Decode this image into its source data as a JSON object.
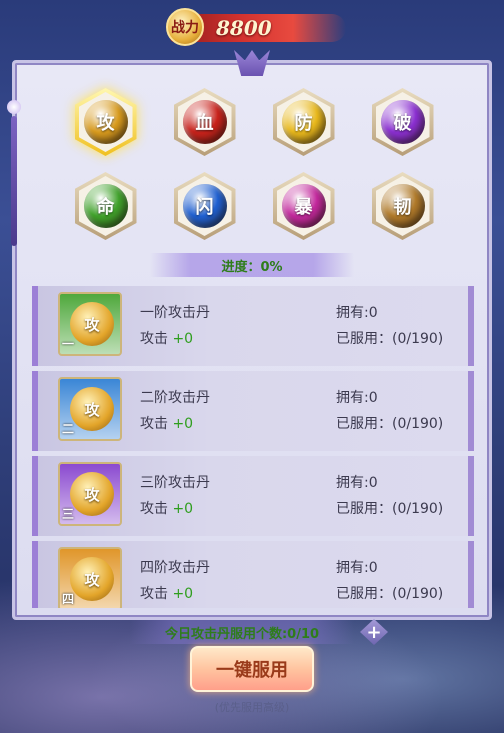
{
  "power": {
    "emblem": "战力",
    "value": "8800"
  },
  "gems": [
    {
      "label": "攻",
      "color": "#d79a1e",
      "selected": true
    },
    {
      "label": "血",
      "color": "#c8221b",
      "selected": false
    },
    {
      "label": "防",
      "color": "#e8b81c",
      "selected": false
    },
    {
      "label": "破",
      "color": "#8a2fd0",
      "selected": false
    },
    {
      "label": "命",
      "color": "#3fa12a",
      "selected": false
    },
    {
      "label": "闪",
      "color": "#1e5fd0",
      "selected": false
    },
    {
      "label": "暴",
      "color": "#c2289c",
      "selected": false
    },
    {
      "label": "韧",
      "color": "#b07a2a",
      "selected": false
    }
  ],
  "progress": {
    "text": "进度：0%"
  },
  "items": [
    {
      "name": "一阶攻击丹",
      "attr_label": "攻击",
      "bonus": "+0",
      "owned": "拥有:0",
      "used": "已服用：(0/190)",
      "tier": "一",
      "icon_bg": "#4fa83c",
      "orb_label": "攻"
    },
    {
      "name": "二阶攻击丹",
      "attr_label": "攻击",
      "bonus": "+0",
      "owned": "拥有:0",
      "used": "已服用：(0/190)",
      "tier": "二",
      "icon_bg": "#3a86d6",
      "orb_label": "攻"
    },
    {
      "name": "三阶攻击丹",
      "attr_label": "攻击",
      "bonus": "+0",
      "owned": "拥有:0",
      "used": "已服用：(0/190)",
      "tier": "三",
      "icon_bg": "#8b4ad0",
      "orb_label": "攻"
    },
    {
      "name": "四阶攻击丹",
      "attr_label": "攻击",
      "bonus": "+0",
      "owned": "拥有:0",
      "used": "已服用：(0/190)",
      "tier": "四",
      "icon_bg": "#e0962a",
      "orb_label": "攻"
    }
  ],
  "daily": {
    "text": "今日攻击丹服用个数:0/10",
    "add_symbol": "+"
  },
  "confirm": {
    "label": "一键服用",
    "note": "(优先服用高级)"
  }
}
